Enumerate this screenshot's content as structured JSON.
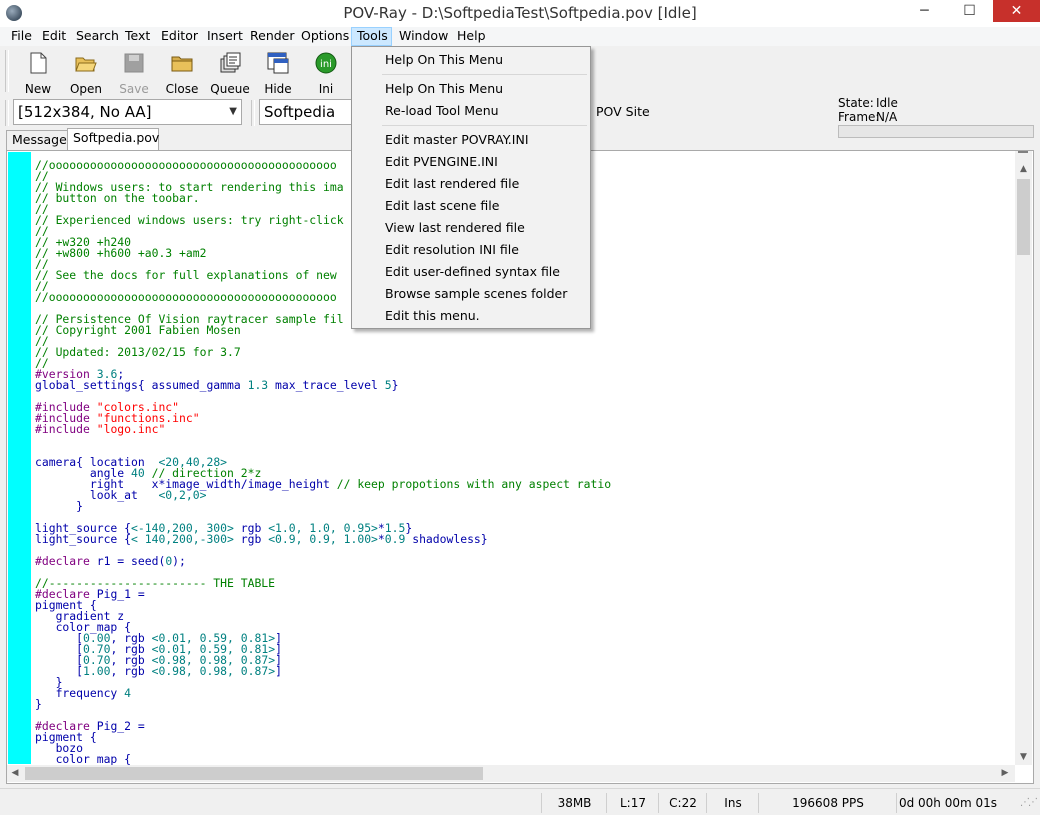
{
  "window": {
    "title": "POV-Ray - D:\\SoftpediaTest\\Softpedia.pov [Idle]",
    "minimize_glyph": "─",
    "maximize_glyph": "☐",
    "close_glyph": "✕"
  },
  "menubar": {
    "items": [
      "File",
      "Edit",
      "Search",
      "Text",
      "Editor",
      "Insert",
      "Render",
      "Options",
      "Tools",
      "Window",
      "Help"
    ],
    "open_item": "Tools"
  },
  "toolbar": {
    "buttons": [
      {
        "label": "New",
        "icon": "new-file-icon",
        "enabled": true
      },
      {
        "label": "Open",
        "icon": "open-folder-icon",
        "enabled": true
      },
      {
        "label": "Save",
        "icon": "save-icon",
        "enabled": false
      },
      {
        "label": "Close",
        "icon": "close-folder-icon",
        "enabled": true
      },
      {
        "label": "Queue",
        "icon": "queue-icon",
        "enabled": true
      },
      {
        "label": "Hide",
        "icon": "hide-icon",
        "enabled": true
      },
      {
        "label": "Ini",
        "icon": "ini-icon",
        "enabled": true
      }
    ],
    "status": {
      "state_label": "State:",
      "state_value": "Idle",
      "frame_label": "Frame:",
      "frame_value": "N/A"
    }
  },
  "row2": {
    "resolution_value": "[512x384, No AA]",
    "search_value": "Softpedia",
    "pov_site_label": "POV Site"
  },
  "tabs": [
    {
      "label": "Messages",
      "active": false
    },
    {
      "label": "Softpedia.pov",
      "active": true
    }
  ],
  "code_lines": [
    [
      [
        "cm",
        "//oooooooooooooooooooooooooooooooooooooooooo"
      ]
    ],
    [
      [
        "cm",
        "//"
      ]
    ],
    [
      [
        "cm",
        "// Windows users: to start rendering this ima"
      ]
    ],
    [
      [
        "cm",
        "// button on the toobar."
      ]
    ],
    [
      [
        "cm",
        "//"
      ]
    ],
    [
      [
        "cm",
        "// Experienced windows users: try right-click"
      ]
    ],
    [
      [
        "cm",
        "//"
      ]
    ],
    [
      [
        "cm",
        "// +w320 +h240"
      ]
    ],
    [
      [
        "cm",
        "// +w800 +h600 +a0.3 +am2"
      ]
    ],
    [
      [
        "cm",
        "//"
      ]
    ],
    [
      [
        "cm",
        "// See the docs for full explanations of new"
      ]
    ],
    [
      [
        "cm",
        "//"
      ]
    ],
    [
      [
        "cm",
        "//oooooooooooooooooooooooooooooooooooooooooo"
      ]
    ],
    [
      [
        "cm",
        ""
      ]
    ],
    [
      [
        "cm",
        "// Persistence Of Vision raytracer sample fil"
      ]
    ],
    [
      [
        "cm",
        "// Copyright 2001 Fabien Mosen"
      ]
    ],
    [
      [
        "cm",
        "//"
      ]
    ],
    [
      [
        "cm",
        "// Updated: 2013/02/15 for 3.7"
      ]
    ],
    [
      [
        "cm",
        "//"
      ]
    ],
    [
      [
        "kw",
        "#version "
      ],
      [
        "nu",
        "3.6"
      ],
      [
        "id",
        ";"
      ]
    ],
    [
      [
        "id",
        "global_settings{ assumed_gamma "
      ],
      [
        "nu",
        "1.3"
      ],
      [
        "id",
        " max_trace_level "
      ],
      [
        "nu",
        "5"
      ],
      [
        "id",
        "}"
      ]
    ],
    [
      [
        "id",
        ""
      ]
    ],
    [
      [
        "kw",
        "#include "
      ],
      [
        "st",
        "\"colors.inc\""
      ]
    ],
    [
      [
        "kw",
        "#include "
      ],
      [
        "st",
        "\"functions.inc\""
      ]
    ],
    [
      [
        "kw",
        "#include "
      ],
      [
        "st",
        "\"logo.inc\""
      ]
    ],
    [
      [
        "id",
        ""
      ]
    ],
    [
      [
        "id",
        ""
      ]
    ],
    [
      [
        "id",
        "camera{ location  "
      ],
      [
        "nu",
        "<20,40,28>"
      ]
    ],
    [
      [
        "id",
        "        angle "
      ],
      [
        "nu",
        "40"
      ],
      [
        "cm",
        " // direction 2*z"
      ]
    ],
    [
      [
        "id",
        "        right    x*image_width/image_height "
      ],
      [
        "cm",
        "// keep propotions with any aspect ratio"
      ]
    ],
    [
      [
        "id",
        "        look_at   "
      ],
      [
        "nu",
        "<0,2,0>"
      ]
    ],
    [
      [
        "id",
        "      }"
      ]
    ],
    [
      [
        "id",
        ""
      ]
    ],
    [
      [
        "id",
        "light_source {"
      ],
      [
        "nu",
        "<-140,200, 300>"
      ],
      [
        "id",
        " rgb "
      ],
      [
        "nu",
        "<1.0, 1.0, 0.95>"
      ],
      [
        "id",
        "*"
      ],
      [
        "nu",
        "1.5"
      ],
      [
        "id",
        "}"
      ]
    ],
    [
      [
        "id",
        "light_source {"
      ],
      [
        "nu",
        "< 140,200,-300>"
      ],
      [
        "id",
        " rgb "
      ],
      [
        "nu",
        "<0.9, 0.9, 1.00>"
      ],
      [
        "id",
        "*"
      ],
      [
        "nu",
        "0.9"
      ],
      [
        "id",
        " shadowless}"
      ]
    ],
    [
      [
        "id",
        ""
      ]
    ],
    [
      [
        "kw",
        "#declare "
      ],
      [
        "id",
        "r1 = seed("
      ],
      [
        "nu",
        "0"
      ],
      [
        "id",
        ");"
      ]
    ],
    [
      [
        "id",
        ""
      ]
    ],
    [
      [
        "cm",
        "//----------------------- THE TABLE"
      ]
    ],
    [
      [
        "kw",
        "#declare "
      ],
      [
        "id",
        "Pig_1 ="
      ]
    ],
    [
      [
        "id",
        "pigment {"
      ]
    ],
    [
      [
        "id",
        "   gradient z"
      ]
    ],
    [
      [
        "id",
        "   color_map {"
      ]
    ],
    [
      [
        "id",
        "      ["
      ],
      [
        "nu",
        "0.00"
      ],
      [
        "id",
        ", rgb "
      ],
      [
        "nu",
        "<0.01, 0.59, 0.81>"
      ],
      [
        "id",
        "]"
      ]
    ],
    [
      [
        "id",
        "      ["
      ],
      [
        "nu",
        "0.70"
      ],
      [
        "id",
        ", rgb "
      ],
      [
        "nu",
        "<0.01, 0.59, 0.81>"
      ],
      [
        "id",
        "]"
      ]
    ],
    [
      [
        "id",
        "      ["
      ],
      [
        "nu",
        "0.70"
      ],
      [
        "id",
        ", rgb "
      ],
      [
        "nu",
        "<0.98, 0.98, 0.87>"
      ],
      [
        "id",
        "]"
      ]
    ],
    [
      [
        "id",
        "      ["
      ],
      [
        "nu",
        "1.00"
      ],
      [
        "id",
        ", rgb "
      ],
      [
        "nu",
        "<0.98, 0.98, 0.87>"
      ],
      [
        "id",
        "]"
      ]
    ],
    [
      [
        "id",
        "   }"
      ]
    ],
    [
      [
        "id",
        "   frequency "
      ],
      [
        "nu",
        "4"
      ]
    ],
    [
      [
        "id",
        "}"
      ]
    ],
    [
      [
        "id",
        ""
      ]
    ],
    [
      [
        "kw",
        "#declare "
      ],
      [
        "id",
        "Pig_2 ="
      ]
    ],
    [
      [
        "id",
        "pigment {"
      ]
    ],
    [
      [
        "id",
        "   bozo"
      ]
    ],
    [
      [
        "id",
        "   color_map {"
      ]
    ]
  ],
  "status_bar": {
    "memory": "38MB",
    "line": "L:17",
    "column": "C:22",
    "mode": "Ins",
    "pps": "196608 PPS",
    "elapsed": "0d 00h 00m 01s"
  },
  "tools_menu": {
    "items": [
      {
        "label": "Help On This Menu",
        "group": 0
      },
      {
        "label": "Help On This Menu",
        "group": 1
      },
      {
        "label": "Re-load Tool Menu",
        "group": 1
      },
      {
        "label": "Edit master POVRAY.INI",
        "group": 2
      },
      {
        "label": "Edit PVENGINE.INI",
        "group": 2
      },
      {
        "label": "Edit last rendered file",
        "group": 2
      },
      {
        "label": "Edit last scene file",
        "group": 2
      },
      {
        "label": "View last rendered file",
        "group": 2
      },
      {
        "label": "Edit resolution INI file",
        "group": 2
      },
      {
        "label": "Edit user-defined syntax file",
        "group": 2
      },
      {
        "label": "Browse sample scenes folder",
        "group": 2
      },
      {
        "label": "Edit this menu.",
        "group": 2
      }
    ]
  },
  "colors": {
    "gutter": "#00ffff",
    "comment": "#008000",
    "keyword": "#800080",
    "string": "#ff0000",
    "number": "#008080",
    "identifier": "#0000aa",
    "menu_highlight": "#cce8ff",
    "close_button": "#c7302b"
  }
}
